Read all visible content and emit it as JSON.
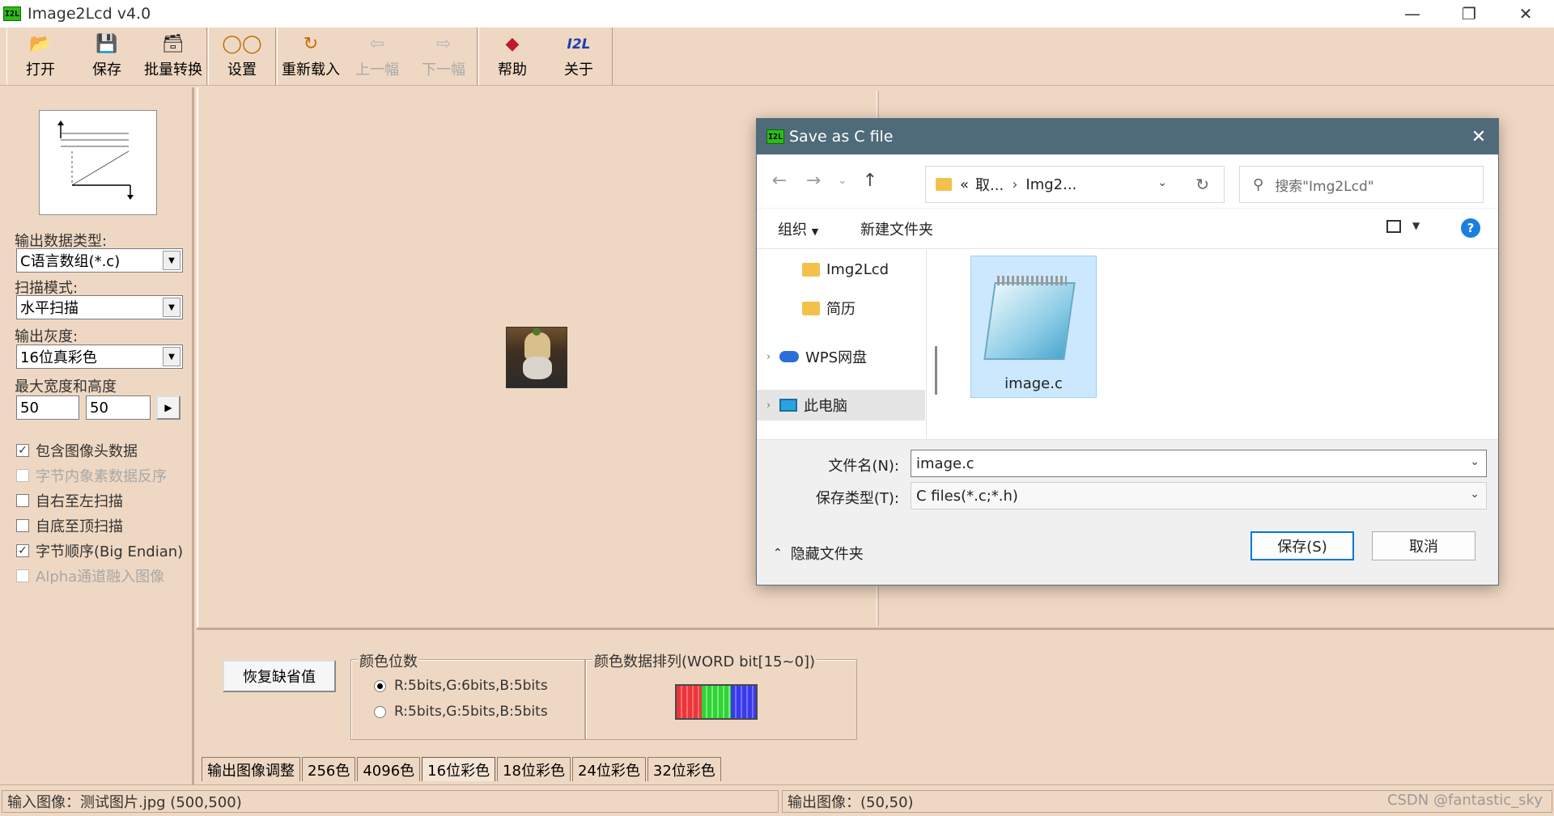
{
  "window": {
    "title": "Image2Lcd v4.0",
    "icon_text": "I2L"
  },
  "toolbar": {
    "open": "打开",
    "save": "保存",
    "batch": "批量转换",
    "settings": "设置",
    "reload": "重新载入",
    "prev": "上一幅",
    "next": "下一幅",
    "help": "帮助",
    "about": "关于",
    "about_icon_text": "I2L"
  },
  "left_panel": {
    "output_type_label": "输出数据类型:",
    "output_type_value": "C语言数组(*.c)",
    "scan_mode_label": "扫描模式:",
    "scan_mode_value": "水平扫描",
    "gray_label": "输出灰度:",
    "gray_value": "16位真彩色",
    "max_size_label": "最大宽度和高度",
    "max_width": "50",
    "max_height": "50",
    "checkboxes": [
      {
        "label": "包含图像头数据",
        "checked": true,
        "enabled": true
      },
      {
        "label": "字节内象素数据反序",
        "checked": false,
        "enabled": false
      },
      {
        "label": "自右至左扫描",
        "checked": false,
        "enabled": true
      },
      {
        "label": "自底至顶扫描",
        "checked": false,
        "enabled": true
      },
      {
        "label": "字节顺序(Big Endian)",
        "checked": true,
        "enabled": true
      },
      {
        "label": "Alpha通道融入图像",
        "checked": false,
        "enabled": false
      }
    ]
  },
  "bottom_panel": {
    "restore_defaults": "恢复缺省值",
    "color_bits_title": "颜色位数",
    "radio_565": "R:5bits,G:6bits,B:5bits",
    "radio_555": "R:5bits,G:5bits,B:5bits",
    "color_order_title": "颜色数据排列(WORD bit[15~0])"
  },
  "tabs": [
    {
      "label": "输出图像调整",
      "active": false
    },
    {
      "label": "256色",
      "active": false
    },
    {
      "label": "4096色",
      "active": false
    },
    {
      "label": "16位彩色",
      "active": true
    },
    {
      "label": "18位彩色",
      "active": false
    },
    {
      "label": "24位彩色",
      "active": false
    },
    {
      "label": "32位彩色",
      "active": false
    }
  ],
  "status": {
    "input": "输入图像：测试图片.jpg (500,500)",
    "output": "输出图像：(50,50)",
    "watermark": "CSDN @fantastic_sky"
  },
  "dialog": {
    "title": "Save as C file",
    "address": {
      "root": "«",
      "part1": "取...",
      "part2": "Img2..."
    },
    "search_placeholder": "搜索\"Img2Lcd\"",
    "organize": "组织",
    "new_folder": "新建文件夹",
    "help": "?",
    "tree": [
      {
        "label": "Img2Lcd",
        "kind": "folder"
      },
      {
        "label": "简历",
        "kind": "folder"
      },
      {
        "label": "WPS网盘",
        "kind": "cloud"
      },
      {
        "label": "此电脑",
        "kind": "pc"
      }
    ],
    "file": {
      "name": "image.c"
    },
    "filename_label": "文件名(N):",
    "filename_value": "image.c",
    "filetype_label": "保存类型(T):",
    "filetype_value": "C files(*.c;*.h)",
    "hide_folders": "隐藏文件夹",
    "save_button": "保存(S)",
    "cancel_button": "取消"
  },
  "colors": {
    "bg": "#efd8c3",
    "dialog_title": "#4f6b7a",
    "accent": "#0078d7"
  }
}
